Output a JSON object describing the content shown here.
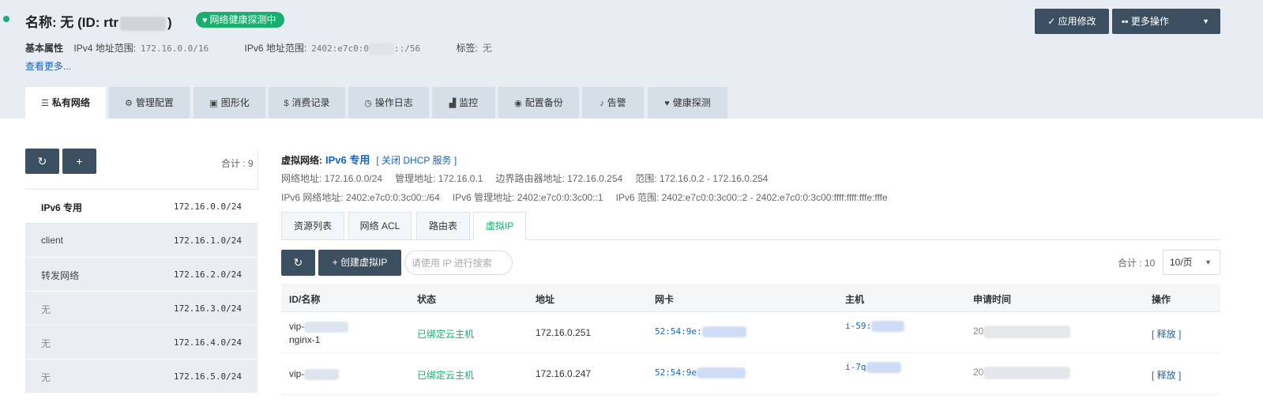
{
  "header": {
    "title_prefix": "名称: 无 (ID: rtr",
    "title_suffix": ")",
    "health_badge": "网络健康探测中",
    "attrs_label": "基本属性",
    "ipv4_label": "IPv4 地址范围:",
    "ipv4_value": "172.16.0.0/16",
    "ipv6_label": "IPv6 地址范围:",
    "ipv6_value_prefix": "2402:e7c0:0",
    "ipv6_value_suffix": "::/56",
    "tag_label": "标签:",
    "tag_value": "无",
    "more_link": "查看更多...",
    "apply_button": "✓ 应用修改",
    "more_actions_button": "更多操作"
  },
  "tabs": [
    {
      "label": "私有网络",
      "icon": "list-icon",
      "glyph": "☰"
    },
    {
      "label": "管理配置",
      "icon": "gears-icon",
      "glyph": "⚙"
    },
    {
      "label": "图形化",
      "icon": "image-icon",
      "glyph": "▣"
    },
    {
      "label": "消费记录",
      "icon": "dollar-icon",
      "glyph": "$"
    },
    {
      "label": "操作日志",
      "icon": "clock-icon",
      "glyph": "◷"
    },
    {
      "label": "监控",
      "icon": "area-chart-icon",
      "glyph": "▟"
    },
    {
      "label": "配置备份",
      "icon": "camera-icon",
      "glyph": "◉"
    },
    {
      "label": "告警",
      "icon": "bell-icon",
      "glyph": "♪"
    },
    {
      "label": "健康探测",
      "icon": "heartbeat-icon",
      "glyph": "♥"
    }
  ],
  "left": {
    "refresh_glyph": "↻",
    "add_glyph": "+",
    "total": "合计 : 9",
    "vnets": [
      {
        "name": "IPv6 专用",
        "cidr": "172.16.0.0/24"
      },
      {
        "name": "client",
        "cidr": "172.16.1.0/24"
      },
      {
        "name": "转发网络",
        "cidr": "172.16.2.0/24"
      },
      {
        "name": "无",
        "cidr": "172.16.3.0/24"
      },
      {
        "name": "无",
        "cidr": "172.16.4.0/24"
      },
      {
        "name": "无",
        "cidr": "172.16.5.0/24"
      }
    ]
  },
  "vnet": {
    "label": "虚拟网络:",
    "name": "IPv6 专用",
    "dhcp_action": "[ 关闭 DHCP 服务 ]",
    "info1": [
      "网络地址: 172.16.0.0/24",
      "管理地址: 172.16.0.1",
      "边界路由器地址: 172.16.0.254",
      "范围: 172.16.0.2 - 172.16.0.254"
    ],
    "info2": [
      "IPv6 网络地址: 2402:e7c0:0:3c00::/64",
      "IPv6 管理地址: 2402:e7c0:0:3c00::1",
      "IPv6 范围: 2402:e7c0:0:3c00::2 - 2402:e7c0:0:3c00:ffff:ffff:fffe:fffe"
    ]
  },
  "subtabs": [
    "资源列表",
    "网络 ACL",
    "路由表",
    "虚拟IP"
  ],
  "toolbar": {
    "refresh_glyph": "↻",
    "create_button": "+ 创建虚拟IP",
    "search_placeholder": "请使用 IP 进行搜索",
    "total": "合计 : 10",
    "page_size": "10/页"
  },
  "table": {
    "columns": [
      "ID/名称",
      "状态",
      "地址",
      "网卡",
      "主机",
      "申请时间",
      "操作"
    ],
    "rows": [
      {
        "id_line1": "vip-",
        "id_line2": "nginx-1",
        "status": "已绑定云主机",
        "address": "172.16.0.251",
        "nic": "52:54:9e:",
        "host": "i-59:",
        "time": "20",
        "action": "[ 释放 ]"
      },
      {
        "id_line1": "vip-",
        "id_line2": "",
        "status": "已绑定云主机",
        "address": "172.16.0.247",
        "nic": "52:54:9e",
        "host": "i-7q",
        "time": "20",
        "action": "[ 释放 ]"
      }
    ]
  },
  "colors": {
    "accent_green": "#1aae6f",
    "dark_button": "#3c4f61",
    "link_blue": "#1565c0",
    "header_bg": "#e7edf2"
  }
}
